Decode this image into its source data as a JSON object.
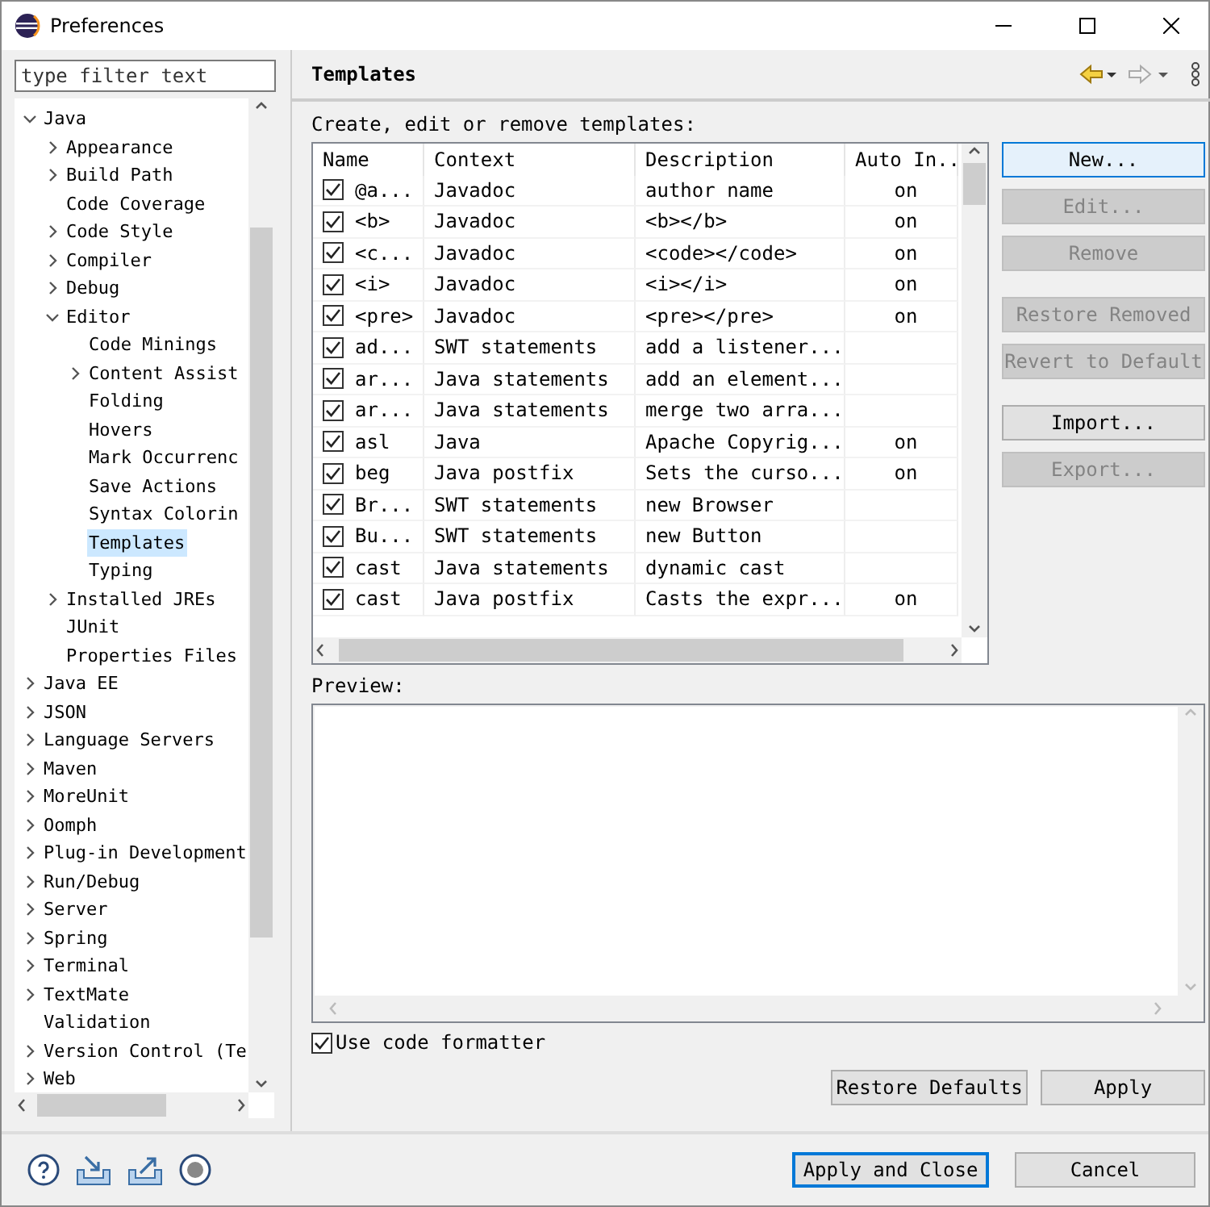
{
  "window": {
    "title": "Preferences"
  },
  "sidebar": {
    "filter": {
      "placeholder": "type filter text"
    },
    "tree": [
      {
        "label": "Java",
        "expandable": true,
        "expanded": true,
        "selected": false,
        "children": [
          {
            "label": "Appearance",
            "expandable": true,
            "expanded": false,
            "selected": false
          },
          {
            "label": "Build Path",
            "expandable": true,
            "expanded": false,
            "selected": false
          },
          {
            "label": "Code Coverage",
            "expandable": false,
            "expanded": false,
            "selected": false
          },
          {
            "label": "Code Style",
            "expandable": true,
            "expanded": false,
            "selected": false
          },
          {
            "label": "Compiler",
            "expandable": true,
            "expanded": false,
            "selected": false
          },
          {
            "label": "Debug",
            "expandable": true,
            "expanded": false,
            "selected": false
          },
          {
            "label": "Editor",
            "expandable": true,
            "expanded": true,
            "selected": false,
            "children": [
              {
                "label": "Code Minings",
                "expandable": false,
                "expanded": false,
                "selected": false
              },
              {
                "label": "Content Assist",
                "expandable": true,
                "expanded": false,
                "selected": false
              },
              {
                "label": "Folding",
                "expandable": false,
                "expanded": false,
                "selected": false
              },
              {
                "label": "Hovers",
                "expandable": false,
                "expanded": false,
                "selected": false
              },
              {
                "label": "Mark Occurrenc",
                "expandable": false,
                "expanded": false,
                "selected": false
              },
              {
                "label": "Save Actions",
                "expandable": false,
                "expanded": false,
                "selected": false
              },
              {
                "label": "Syntax Colorin",
                "expandable": false,
                "expanded": false,
                "selected": false
              },
              {
                "label": "Templates",
                "expandable": false,
                "expanded": false,
                "selected": true
              },
              {
                "label": "Typing",
                "expandable": false,
                "expanded": false,
                "selected": false
              }
            ]
          },
          {
            "label": "Installed JREs",
            "expandable": true,
            "expanded": false,
            "selected": false
          },
          {
            "label": "JUnit",
            "expandable": false,
            "expanded": false,
            "selected": false
          },
          {
            "label": "Properties Files",
            "expandable": false,
            "expanded": false,
            "selected": false
          }
        ]
      },
      {
        "label": "Java EE",
        "expandable": true,
        "expanded": false,
        "selected": false
      },
      {
        "label": "JSON",
        "expandable": true,
        "expanded": false,
        "selected": false
      },
      {
        "label": "Language Servers",
        "expandable": true,
        "expanded": false,
        "selected": false
      },
      {
        "label": "Maven",
        "expandable": true,
        "expanded": false,
        "selected": false
      },
      {
        "label": "MoreUnit",
        "expandable": true,
        "expanded": false,
        "selected": false
      },
      {
        "label": "Oomph",
        "expandable": true,
        "expanded": false,
        "selected": false
      },
      {
        "label": "Plug-in Development",
        "expandable": true,
        "expanded": false,
        "selected": false
      },
      {
        "label": "Run/Debug",
        "expandable": true,
        "expanded": false,
        "selected": false
      },
      {
        "label": "Server",
        "expandable": true,
        "expanded": false,
        "selected": false
      },
      {
        "label": "Spring",
        "expandable": true,
        "expanded": false,
        "selected": false
      },
      {
        "label": "Terminal",
        "expandable": true,
        "expanded": false,
        "selected": false
      },
      {
        "label": "TextMate",
        "expandable": true,
        "expanded": false,
        "selected": false
      },
      {
        "label": "Validation",
        "expandable": false,
        "expanded": false,
        "selected": false
      },
      {
        "label": "Version Control (Te",
        "expandable": true,
        "expanded": false,
        "selected": false
      },
      {
        "label": "Web",
        "expandable": true,
        "expanded": false,
        "selected": false
      }
    ]
  },
  "page": {
    "title": "Templates",
    "intro": "Create, edit or remove templates:",
    "table": {
      "columns": [
        "Name",
        "Context",
        "Description",
        "Auto In.."
      ],
      "rows": [
        {
          "checked": true,
          "name": "@a...",
          "context": "Javadoc",
          "description": "author name",
          "auto_insert": "on"
        },
        {
          "checked": true,
          "name": "<b>",
          "context": "Javadoc",
          "description": "<b></b>",
          "auto_insert": "on"
        },
        {
          "checked": true,
          "name": "<c...",
          "context": "Javadoc",
          "description": "<code></code>",
          "auto_insert": "on"
        },
        {
          "checked": true,
          "name": "<i>",
          "context": "Javadoc",
          "description": "<i></i>",
          "auto_insert": "on"
        },
        {
          "checked": true,
          "name": "<pre>",
          "context": "Javadoc",
          "description": "<pre></pre>",
          "auto_insert": "on"
        },
        {
          "checked": true,
          "name": "ad...",
          "context": "SWT statements",
          "description": "add a listener..."
        },
        {
          "checked": true,
          "name": "ar...",
          "context": "Java statements",
          "description": "add an element..."
        },
        {
          "checked": true,
          "name": "ar...",
          "context": "Java statements",
          "description": "merge two arra..."
        },
        {
          "checked": true,
          "name": "asl",
          "context": "Java",
          "description": "Apache Copyrig...",
          "auto_insert": "on"
        },
        {
          "checked": true,
          "name": "beg",
          "context": "Java postfix",
          "description": "Sets the curso...",
          "auto_insert": "on"
        },
        {
          "checked": true,
          "name": "Br...",
          "context": "SWT statements",
          "description": "new Browser"
        },
        {
          "checked": true,
          "name": "Bu...",
          "context": "SWT statements",
          "description": "new Button"
        },
        {
          "checked": true,
          "name": "cast",
          "context": "Java statements",
          "description": "dynamic cast"
        },
        {
          "checked": true,
          "name": "cast",
          "context": "Java postfix",
          "description": "Casts the expr...",
          "auto_insert": "on"
        }
      ]
    },
    "side_button_groups": [
      [
        {
          "label": "New...",
          "disabled": false,
          "focused": true
        },
        {
          "label": "Edit...",
          "disabled": true,
          "focused": false
        },
        {
          "label": "Remove",
          "disabled": true,
          "focused": false
        }
      ],
      [
        {
          "label": "Restore Removed",
          "disabled": true,
          "focused": false
        },
        {
          "label": "Revert to Default",
          "disabled": true,
          "focused": false
        }
      ],
      [
        {
          "label": "Import...",
          "disabled": false,
          "focused": false
        },
        {
          "label": "Export...",
          "disabled": true,
          "focused": false
        }
      ]
    ],
    "preview_label": "Preview:",
    "use_code_formatter": {
      "label": "Use code formatter",
      "checked": true
    },
    "buttons": [
      {
        "label": "Restore Defaults"
      },
      {
        "label": "Apply"
      }
    ]
  },
  "footer": {
    "buttons": [
      {
        "label": "Apply and Close",
        "default": true
      },
      {
        "label": "Cancel",
        "default": false
      }
    ]
  }
}
